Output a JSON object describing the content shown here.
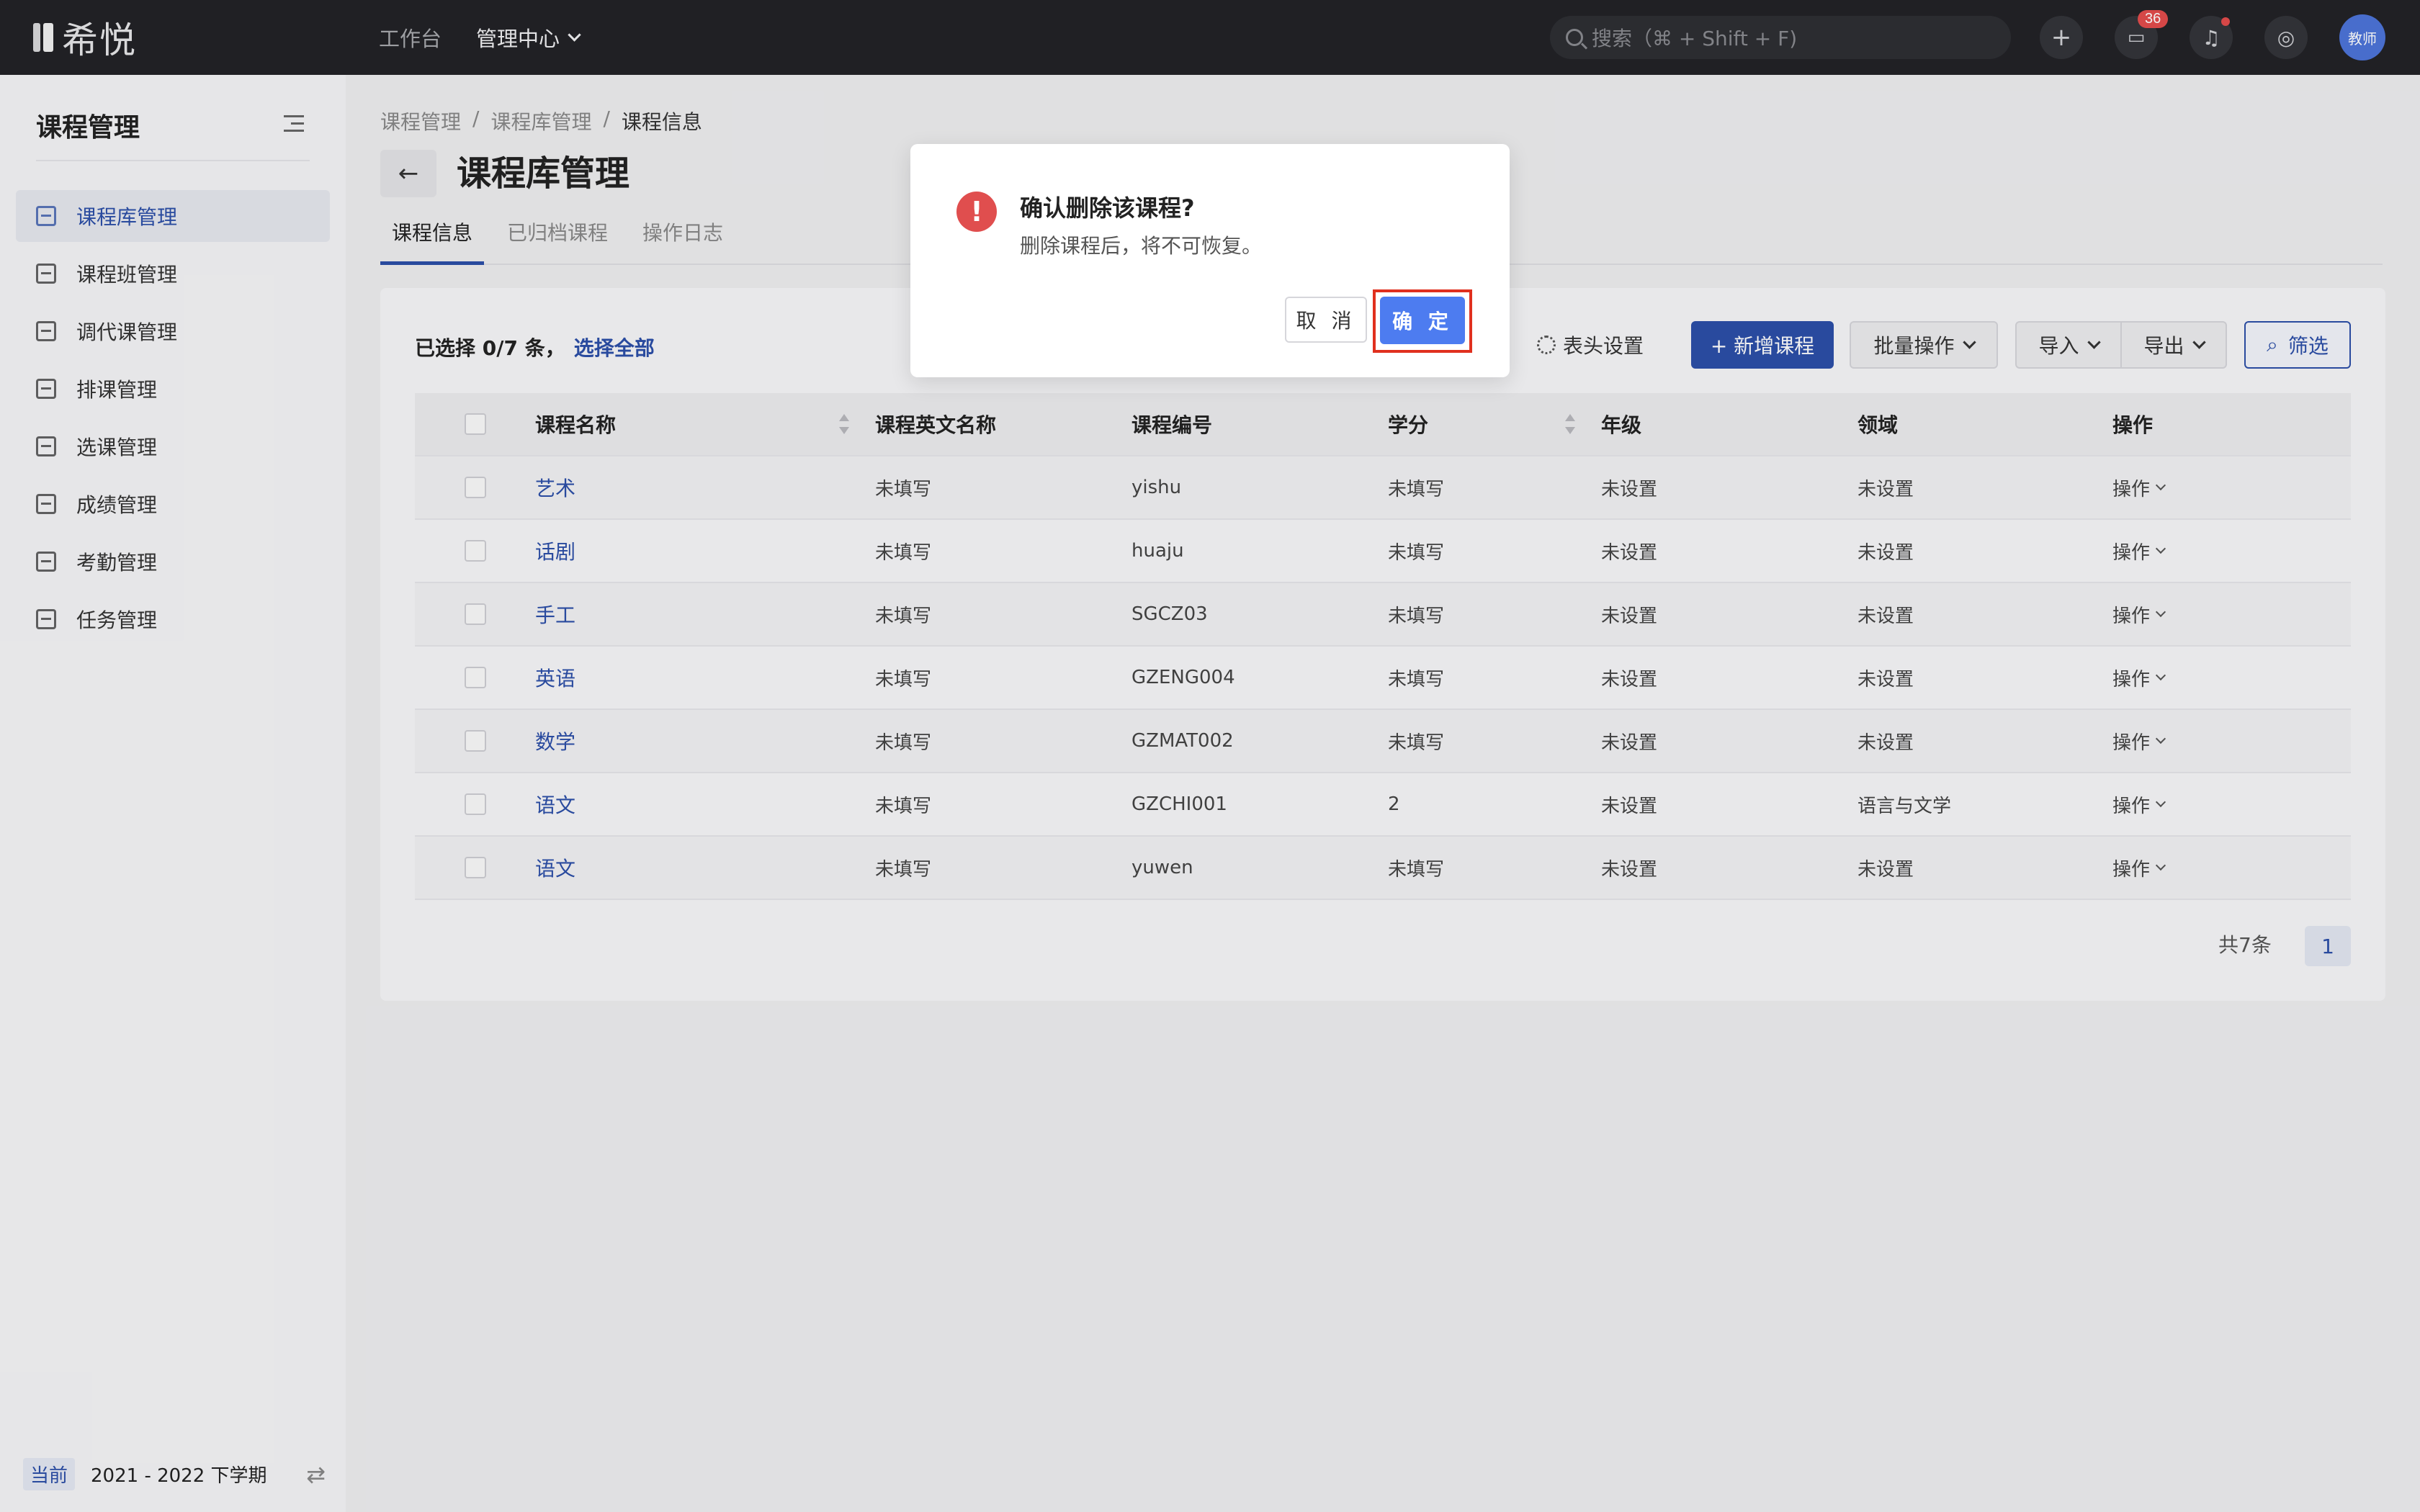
{
  "app": {
    "logo_text": "希悦"
  },
  "topnav": {
    "workbench": "工作台",
    "management": "管理中心"
  },
  "search": {
    "placeholder": "搜索（⌘ + Shift + F)"
  },
  "topbar_icons": {
    "add": "plus-icon",
    "messages": "message-icon",
    "messages_badge": "36",
    "notifications": "bell-icon",
    "help": "help-icon",
    "avatar_label": "教师"
  },
  "sidebar": {
    "title": "课程管理",
    "items": [
      {
        "label": "课程库管理",
        "icon": "library-icon",
        "active": true
      },
      {
        "label": "课程班管理",
        "icon": "class-icon",
        "active": false
      },
      {
        "label": "调代课管理",
        "icon": "swap-class-icon",
        "active": false
      },
      {
        "label": "排课管理",
        "icon": "schedule-icon",
        "active": false
      },
      {
        "label": "选课管理",
        "icon": "select-course-icon",
        "active": false
      },
      {
        "label": "成绩管理",
        "icon": "grade-icon",
        "active": false
      },
      {
        "label": "考勤管理",
        "icon": "attendance-icon",
        "active": false
      },
      {
        "label": "任务管理",
        "icon": "task-icon",
        "active": false
      }
    ],
    "footer": {
      "tag": "当前",
      "term": "2021 - 2022 下学期"
    }
  },
  "breadcrumb": [
    "课程管理",
    "课程库管理",
    "课程信息"
  ],
  "breadcrumb_sep": "/",
  "page": {
    "title": "课程库管理"
  },
  "tabs": [
    "课程信息",
    "已归档课程",
    "操作日志"
  ],
  "selection": {
    "text": "已选择 0/7 条，",
    "select_all": "选择全部"
  },
  "toolbar": {
    "column_settings": "表头设置",
    "add_course": "+ 新增课程",
    "batch": "批量操作",
    "import": "导入",
    "export": "导出",
    "filter": "筛选"
  },
  "table": {
    "headers": [
      "课程名称",
      "课程英文名称",
      "课程编号",
      "学分",
      "年级",
      "领域",
      "操作"
    ],
    "rows": [
      {
        "name": "艺术",
        "en": "未填写",
        "code": "yishu",
        "credit": "未填写",
        "grade": "未设置",
        "field": "未设置",
        "op": "操作"
      },
      {
        "name": "话剧",
        "en": "未填写",
        "code": "huaju",
        "credit": "未填写",
        "grade": "未设置",
        "field": "未设置",
        "op": "操作"
      },
      {
        "name": "手工",
        "en": "未填写",
        "code": "SGCZ03",
        "credit": "未填写",
        "grade": "未设置",
        "field": "未设置",
        "op": "操作"
      },
      {
        "name": "英语",
        "en": "未填写",
        "code": "GZENG004",
        "credit": "未填写",
        "grade": "未设置",
        "field": "未设置",
        "op": "操作"
      },
      {
        "name": "数学",
        "en": "未填写",
        "code": "GZMAT002",
        "credit": "未填写",
        "grade": "未设置",
        "field": "未设置",
        "op": "操作"
      },
      {
        "name": "语文",
        "en": "未填写",
        "code": "GZCHI001",
        "credit": "2",
        "grade": "未设置",
        "field": "语言与文学",
        "op": "操作"
      },
      {
        "name": "语文",
        "en": "未填写",
        "code": "yuwen",
        "credit": "未填写",
        "grade": "未设置",
        "field": "未设置",
        "op": "操作"
      }
    ]
  },
  "pagination": {
    "total": "共7条",
    "current": "1"
  },
  "modal": {
    "title": "确认删除该课程?",
    "description": "删除课程后，将不可恢复。",
    "cancel": "取 消",
    "confirm": "确 定",
    "icon": "exclamation-icon",
    "highlight_color": "#e0301e"
  },
  "colors": {
    "accent": "#2c4fa8",
    "topbar": "#222327",
    "danger": "#e04e4e",
    "confirm": "#4d7cf0"
  }
}
